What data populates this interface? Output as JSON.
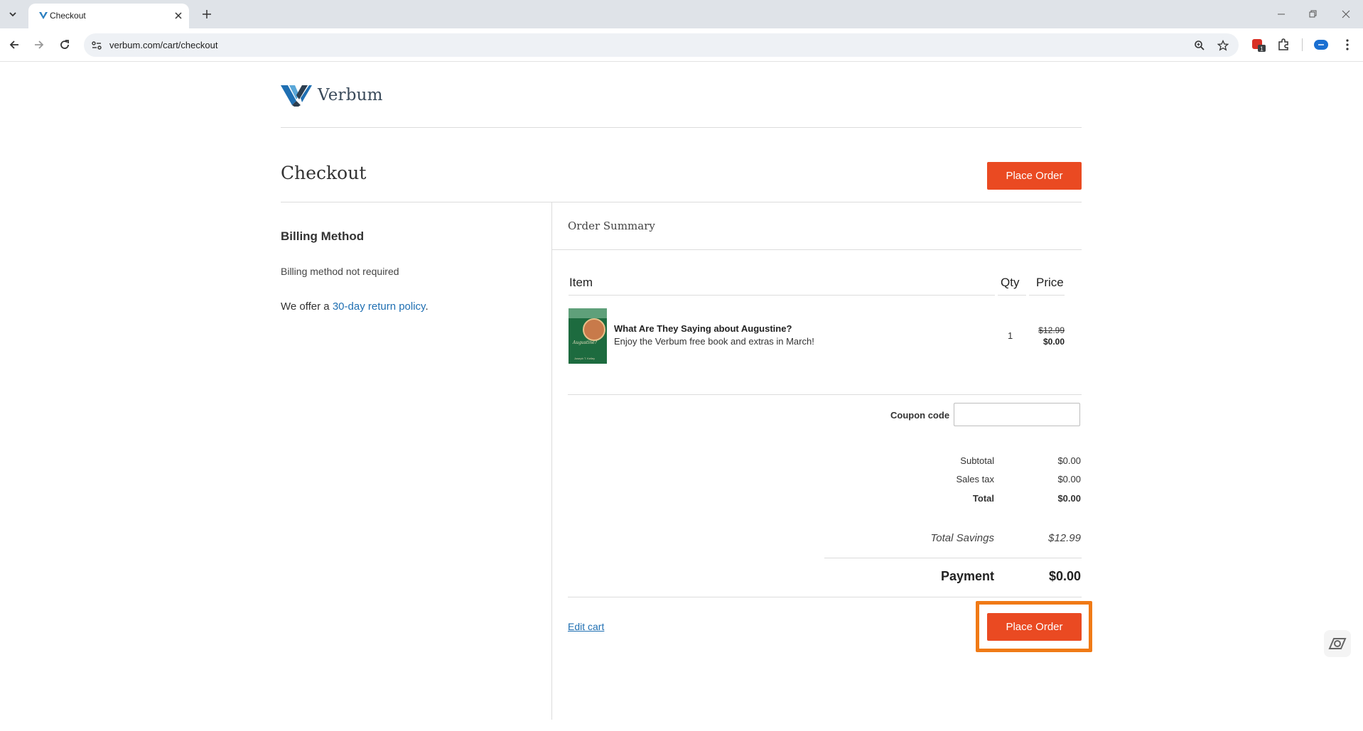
{
  "browser": {
    "tab_title": "Checkout",
    "url": "verbum.com/cart/checkout",
    "extension_badge": "1"
  },
  "brand": {
    "name": "Verbum",
    "accent": "#ea4a22",
    "link_color": "#1f6fb2"
  },
  "page": {
    "title": "Checkout",
    "place_order_label": "Place Order"
  },
  "billing": {
    "title": "Billing Method",
    "note": "Billing method not required",
    "return_prefix": "We offer a ",
    "return_link": "30-day return policy",
    "return_suffix": "."
  },
  "summary": {
    "title": "Order Summary",
    "columns": [
      "Item",
      "Qty",
      "Price"
    ],
    "items": [
      {
        "title": "What Are They Saying about Augustine?",
        "description": "Enjoy the Verbum free book and extras in March!",
        "qty": "1",
        "price_original": "$12.99",
        "price_final": "$0.00",
        "cover_text": "Augustine?",
        "cover_author": "Joseph T. Kelley",
        "cover_series": "WATSA"
      }
    ],
    "coupon_label": "Coupon code",
    "coupon_value": "",
    "subtotal_label": "Subtotal",
    "subtotal": "$0.00",
    "tax_label": "Sales tax",
    "tax": "$0.00",
    "total_label": "Total",
    "total": "$0.00",
    "savings_label": "Total Savings",
    "savings": "$12.99",
    "payment_label": "Payment",
    "payment": "$0.00",
    "edit_cart": "Edit cart"
  }
}
